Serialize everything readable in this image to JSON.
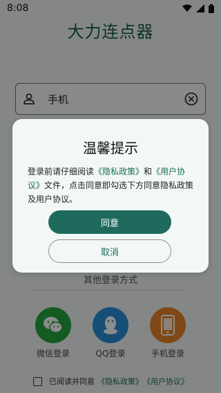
{
  "status_bar": {
    "time": "8:08"
  },
  "app_title": "大力连点器",
  "phone_input": {
    "label": "手机"
  },
  "other_login": {
    "title": "其他登录方式",
    "options": [
      {
        "label": "微信登录",
        "icon": "wechat-icon",
        "color": "#23a540"
      },
      {
        "label": "QQ登录",
        "icon": "qq-icon",
        "color": "#2b8fd8"
      },
      {
        "label": "手机登录",
        "icon": "phone-icon",
        "color": "#e8862a"
      }
    ]
  },
  "agreement": {
    "prefix": "已阅读并同意",
    "privacy": "《隐私政策》",
    "user": "《用户协议》"
  },
  "dialog": {
    "title": "温馨提示",
    "body_pre": "登录前请仔细阅读",
    "privacy_link": "《隐私政策》",
    "and": "和",
    "user_link": "《用户协议》",
    "body_post": "文件，点击同意即勾选下方同意隐私政策及用户协议。",
    "agree": "同意",
    "cancel": "取消"
  },
  "colors": {
    "brand": "#1e6b5e"
  }
}
